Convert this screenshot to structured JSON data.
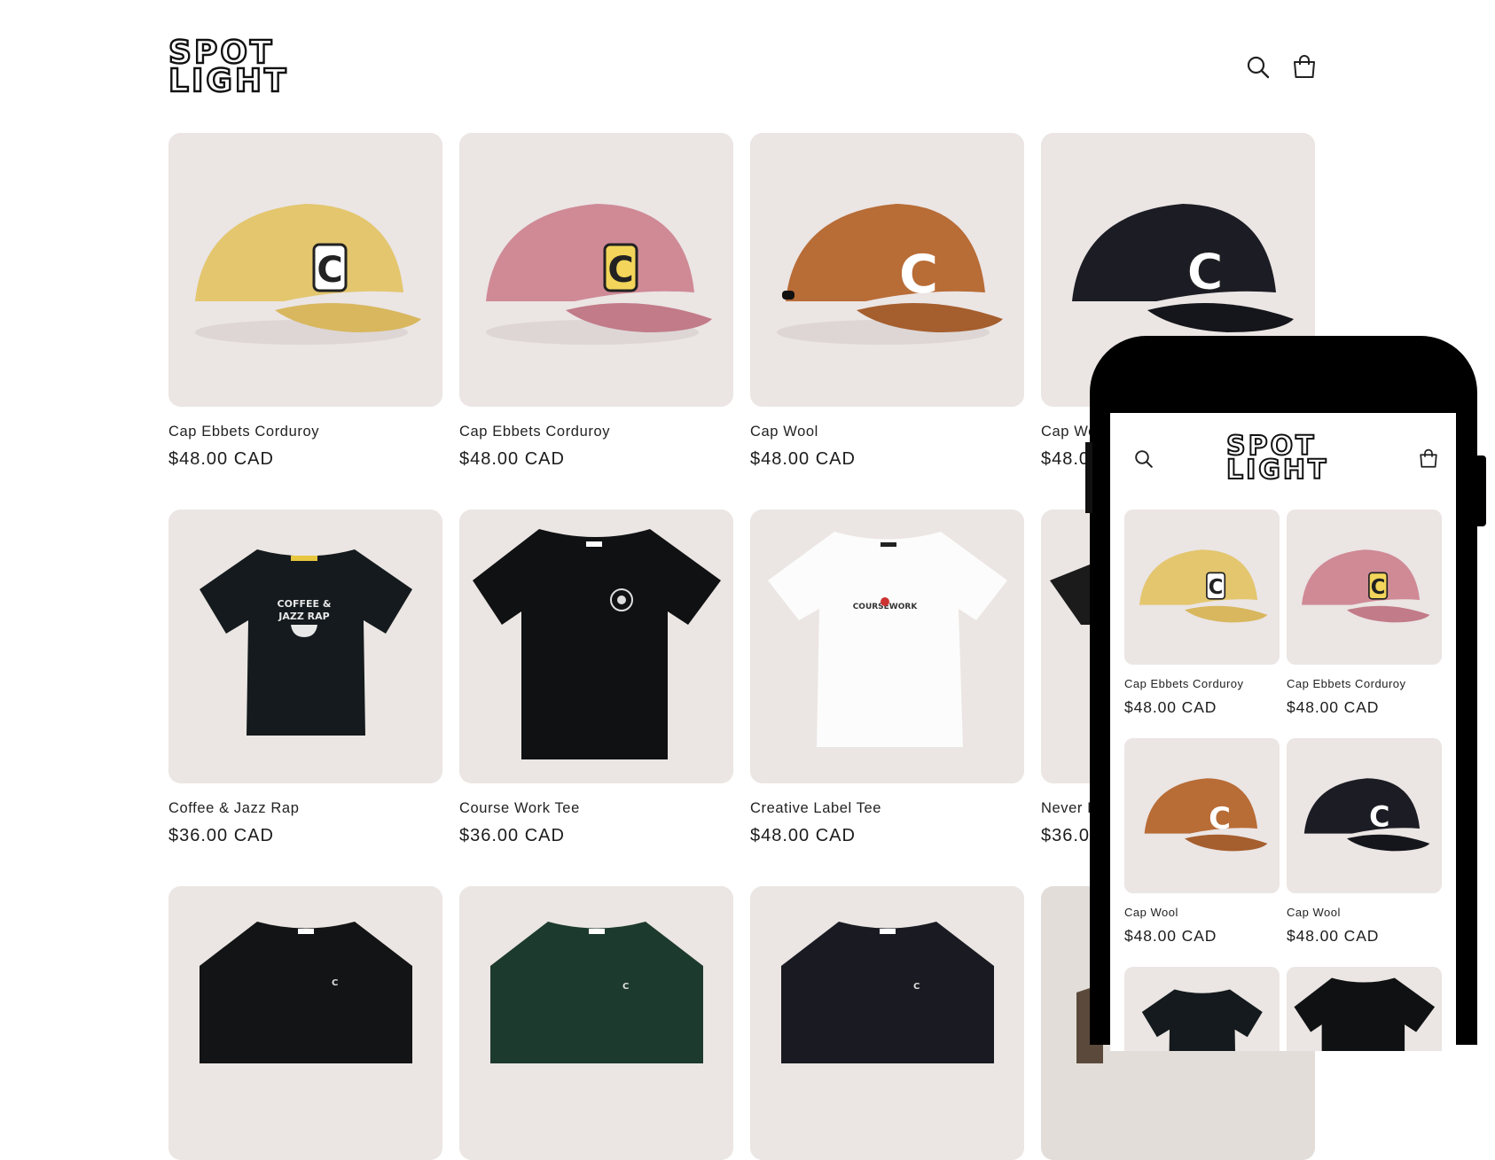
{
  "brand": {
    "logo_line1": "SPOT",
    "logo_line2": "LIGHT"
  },
  "header": {
    "search_icon": "search-icon",
    "cart_icon": "cart-icon"
  },
  "colors": {
    "yellow_cap": "#e3c66e",
    "pink_cap": "#cf8a96",
    "rust_cap": "#b86c36",
    "black_cap": "#1c1d24",
    "tile_bg": "#e9e4e4"
  },
  "products": [
    {
      "title": "Cap Ebbets Corduroy",
      "price": "$48.00 CAD"
    },
    {
      "title": "Cap Ebbets Corduroy",
      "price": "$48.00 CAD"
    },
    {
      "title": "Cap Wool",
      "price": "$48.00 CAD"
    },
    {
      "title": "Cap Wo",
      "price": "$48.0"
    },
    {
      "title": "Coffee & Jazz Rap",
      "price": "$36.00 CAD"
    },
    {
      "title": "Course Work Tee",
      "price": "$36.00 CAD"
    },
    {
      "title": "Creative Label Tee",
      "price": "$48.00 CAD"
    },
    {
      "title": "Never N",
      "price": "$36.0"
    }
  ],
  "mobile": {
    "products": [
      {
        "title": "Cap Ebbets Corduroy",
        "price": "$48.00 CAD"
      },
      {
        "title": "Cap Ebbets Corduroy",
        "price": "$48.00 CAD"
      },
      {
        "title": "Cap Wool",
        "price": "$48.00 CAD"
      },
      {
        "title": "Cap Wool",
        "price": "$48.00 CAD"
      }
    ]
  }
}
